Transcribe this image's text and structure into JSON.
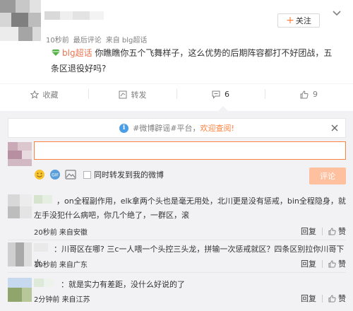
{
  "post": {
    "follow_label": "关注",
    "meta": {
      "time": "10秒前",
      "last_comment": "最后评论",
      "source": "来自 blg超话"
    },
    "topic_link": "blg超话",
    "body": " 你瞧瞧你五个飞舞样子，这么优势的后期阵容都打不好团战，五条区退役好吗?",
    "actions": [
      {
        "label": "收藏",
        "icon": "star-icon"
      },
      {
        "label": "转发",
        "icon": "repost-icon"
      },
      {
        "label": "6",
        "icon": "comment-icon"
      },
      {
        "label": "9",
        "icon": "like-icon"
      }
    ]
  },
  "notice": {
    "prefix": "#微博辟谣#平台，",
    "highlight": "欢迎查阅!"
  },
  "compose": {
    "input_value": "",
    "repost_label": "同时转发到我的微博",
    "submit_label": "评论",
    "tools": [
      "emoji-icon",
      "gif-icon",
      "image-icon"
    ]
  },
  "comments": [
    {
      "text": "，on全程副作用，elk拿两个头也是毫无用处，北川更是没有惩戒，bin全程隐身，就左手没犯什么病吧，你几个绝了，一群区，滚",
      "time": "20秒前",
      "source": "来自安徽",
      "reply": "回复",
      "like": "赞"
    },
    {
      "text": "：川哥区在哪? 三c一人喂一个头控三头龙，拼输一次惩戒就区？四条区别拉你川哥下水",
      "time": "10秒前",
      "source": "来自广东",
      "reply": "回复",
      "like": "赞"
    },
    {
      "text": "：就是实力有差距，没什么好说的了",
      "time": "2分钟前",
      "source": "来自江苏",
      "reply": "回复",
      "like": "赞"
    }
  ]
}
